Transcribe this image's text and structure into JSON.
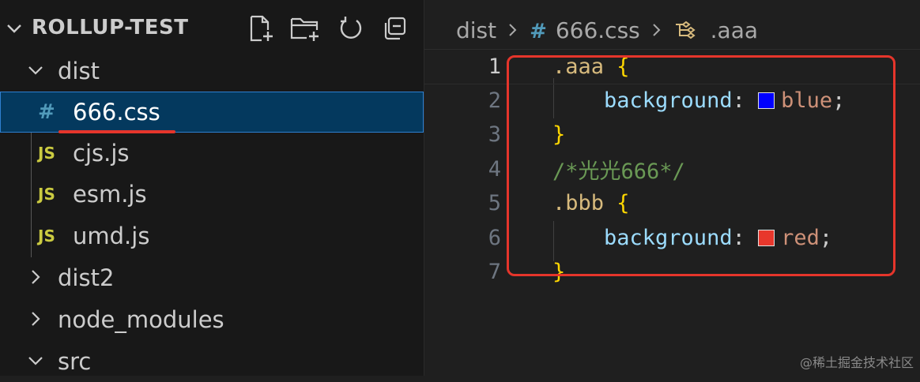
{
  "explorer": {
    "title": "ROLLUP-TEST",
    "actions": [
      {
        "icon": "new-file-icon"
      },
      {
        "icon": "new-folder-icon"
      },
      {
        "icon": "refresh-icon"
      },
      {
        "icon": "collapse-all-icon"
      }
    ],
    "tree": [
      {
        "type": "folder",
        "label": "dist",
        "expanded": true
      },
      {
        "type": "file",
        "icon_text": "#",
        "label": "666.css",
        "selected": true
      },
      {
        "type": "file",
        "icon_text": "JS",
        "label": "cjs.js"
      },
      {
        "type": "file",
        "icon_text": "JS",
        "label": "esm.js"
      },
      {
        "type": "file",
        "icon_text": "JS",
        "label": "umd.js"
      },
      {
        "type": "folder",
        "label": "dist2",
        "expanded": false
      },
      {
        "type": "folder",
        "label": "node_modules",
        "expanded": false
      },
      {
        "type": "folder",
        "label": "src",
        "expanded": true
      }
    ]
  },
  "breadcrumb": {
    "folder": "dist",
    "file_icon": "#",
    "file": "666.css",
    "symbol": ".aaa"
  },
  "code": {
    "current_line": 1,
    "lines": [
      {
        "n": "1",
        "tokens": [
          {
            "t": ".aaa",
            "c": "selector"
          },
          {
            "t": " ",
            "c": "punct"
          },
          {
            "t": "{",
            "c": "brace"
          }
        ]
      },
      {
        "n": "2",
        "tokens": [
          {
            "t": "    background",
            "c": "prop"
          },
          {
            "t": ": ",
            "c": "punct"
          },
          {
            "swatch": "#0000ff"
          },
          {
            "t": "blue",
            "c": "val"
          },
          {
            "t": ";",
            "c": "punct"
          }
        ]
      },
      {
        "n": "3",
        "tokens": [
          {
            "t": "}",
            "c": "brace"
          }
        ]
      },
      {
        "n": "4",
        "tokens": [
          {
            "t": "/*光光666*/",
            "c": "comment"
          }
        ]
      },
      {
        "n": "5",
        "tokens": [
          {
            "t": ".bbb",
            "c": "selector"
          },
          {
            "t": " ",
            "c": "punct"
          },
          {
            "t": "{",
            "c": "brace"
          }
        ]
      },
      {
        "n": "6",
        "tokens": [
          {
            "t": "    background",
            "c": "prop"
          },
          {
            "t": ": ",
            "c": "punct"
          },
          {
            "swatch": "#e8372c"
          },
          {
            "t": "red",
            "c": "val"
          },
          {
            "t": ";",
            "c": "punct"
          }
        ]
      },
      {
        "n": "7",
        "tokens": [
          {
            "t": "}",
            "c": "brace"
          }
        ]
      }
    ]
  },
  "watermark": "@稀土掘金技术社区",
  "colors": {
    "annotation_red": "#e5352b",
    "selection_bg": "#04395e",
    "css_icon": "#519aba",
    "js_icon": "#cbcb41"
  }
}
